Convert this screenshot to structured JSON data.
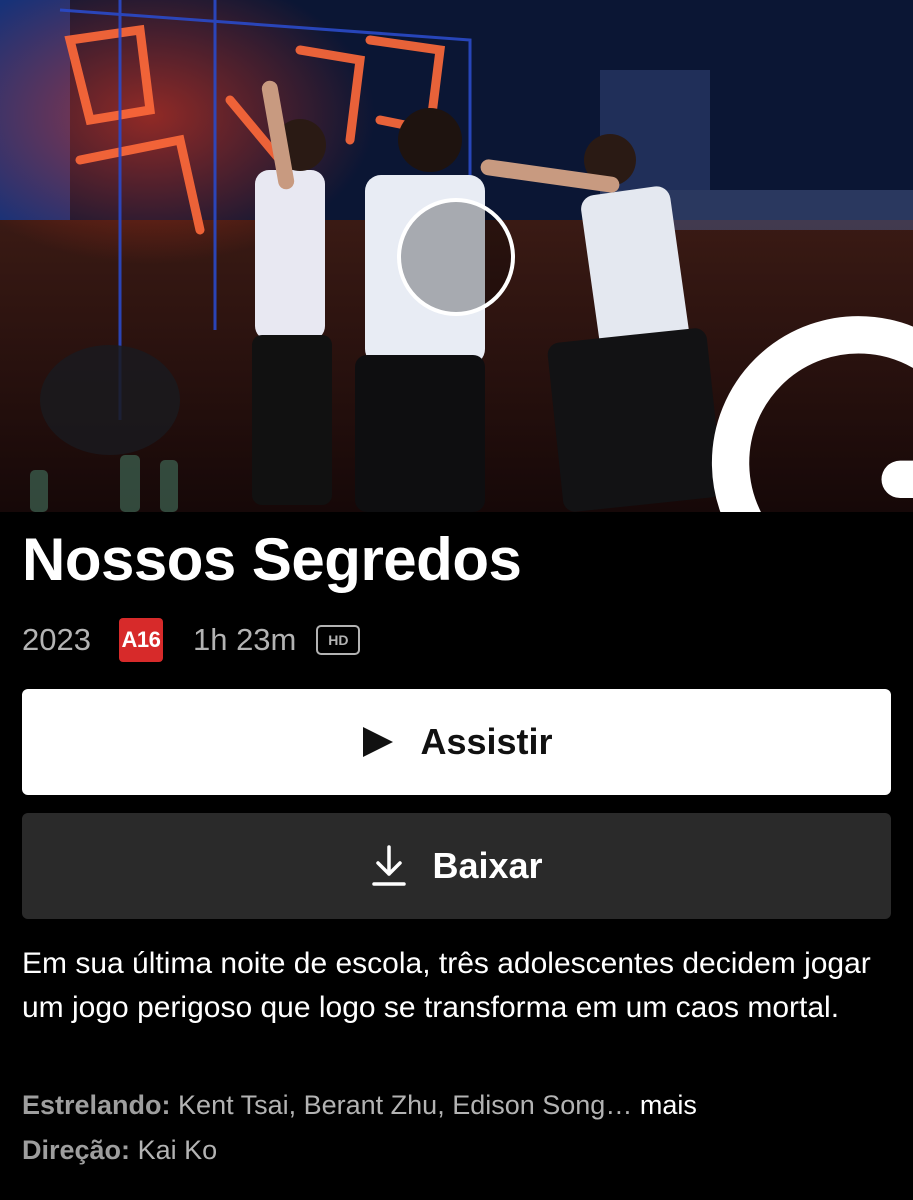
{
  "title": "Nossos Segredos",
  "meta": {
    "year": "2023",
    "rating": "A16",
    "duration": "1h 23m",
    "quality": "HD"
  },
  "colors": {
    "rating_red": "#d72a2a",
    "play_button_bg": "#ffffff",
    "download_button_bg": "#2a2a2a"
  },
  "icons": {
    "replay": "replay-icon",
    "play": "play-icon",
    "download": "download-icon"
  },
  "actions": {
    "play_label": "Assistir",
    "download_label": "Baixar"
  },
  "description": "Em sua última noite de escola, três adolescentes decidem jogar um jogo perigoso que logo se transforma em um caos mortal.",
  "cast": {
    "label": "Estrelando:",
    "names": "Kent Tsai, Berant Zhu, Edison Song…",
    "more": "mais"
  },
  "director": {
    "label": "Direção:",
    "names": "Kai Ko"
  }
}
